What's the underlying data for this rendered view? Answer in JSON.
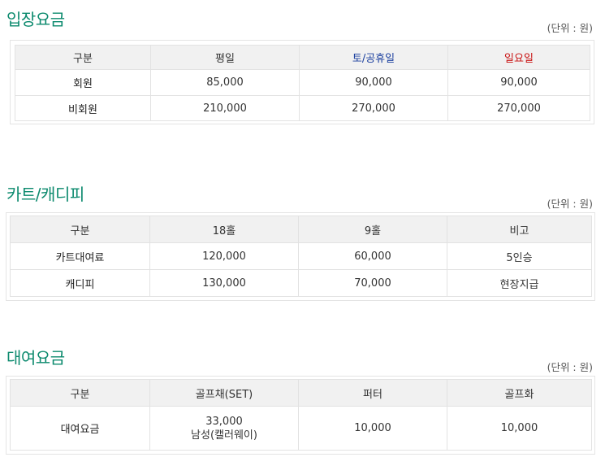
{
  "admission": {
    "title": "입장요금",
    "unit": "(단위 : 원)",
    "headers": [
      "구분",
      "평일",
      "토/공휴일",
      "일요일"
    ],
    "rows": [
      [
        "회원",
        "85,000",
        "90,000",
        "90,000"
      ],
      [
        "비회원",
        "210,000",
        "270,000",
        "270,000"
      ]
    ],
    "colors": {
      "holiday": "#1a3e9e",
      "sunday": "#c81010",
      "title": "#0c8a6e"
    }
  },
  "cart": {
    "title": "카트/캐디피",
    "unit": "(단위 : 원)",
    "headers": [
      "구분",
      "18홀",
      "9홀",
      "비고"
    ],
    "rows": [
      [
        "카트대여료",
        "120,000",
        "60,000",
        "5인승"
      ],
      [
        "캐디피",
        "130,000",
        "70,000",
        "현장지급"
      ]
    ]
  },
  "rental": {
    "title": "대여요금",
    "unit": "(단위 : 원)",
    "headers": [
      "구분",
      "골프채(SET)",
      "퍼터",
      "골프화"
    ],
    "rows": [
      [
        "대여요금",
        "33,000",
        "남성(캘러웨이)",
        "10,000",
        "10,000"
      ]
    ]
  }
}
